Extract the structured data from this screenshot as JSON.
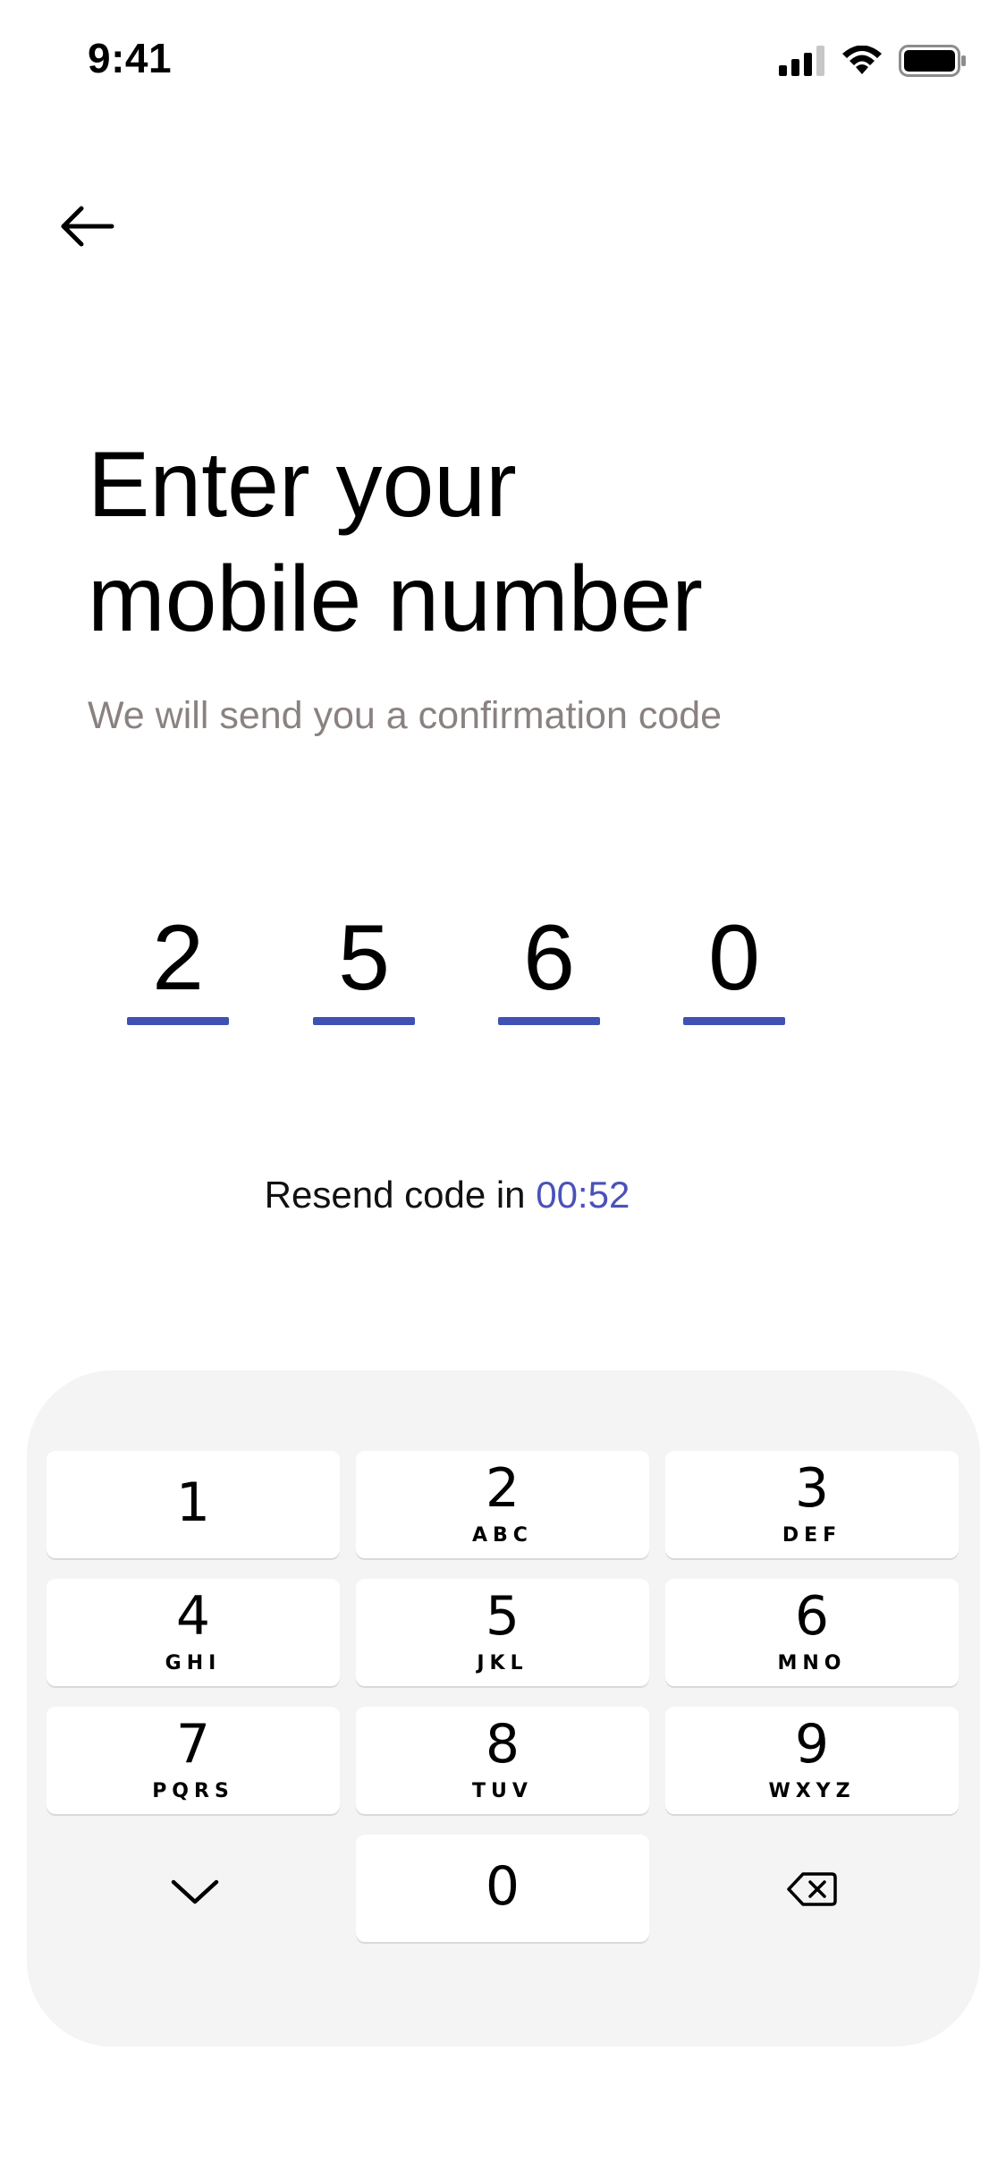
{
  "status_bar": {
    "time": "9:41",
    "icons": [
      "cellular-signal-icon",
      "wifi-icon",
      "battery-icon"
    ]
  },
  "header": {
    "back_icon": "arrow-left-icon"
  },
  "title": {
    "line1": "Enter your",
    "line2": "mobile number"
  },
  "subtitle": "We will send you a confirmation code",
  "code": {
    "digits": [
      "2",
      "5",
      "6",
      "0"
    ],
    "underline_color": "#3f51b5"
  },
  "resend": {
    "label": "Resend code in ",
    "timer": "00:52"
  },
  "keypad": {
    "keys": [
      {
        "digit": "1",
        "letters": ""
      },
      {
        "digit": "2",
        "letters": "ABC"
      },
      {
        "digit": "3",
        "letters": "DEF"
      },
      {
        "digit": "4",
        "letters": "GHI"
      },
      {
        "digit": "5",
        "letters": "JKL"
      },
      {
        "digit": "6",
        "letters": "MNO"
      },
      {
        "digit": "7",
        "letters": "PQRS"
      },
      {
        "digit": "8",
        "letters": "TUV"
      },
      {
        "digit": "9",
        "letters": "WXYZ"
      },
      {
        "digit": "0",
        "letters": ""
      }
    ],
    "hide_icon": "chevron-down-icon",
    "delete_icon": "backspace-icon"
  },
  "colors": {
    "accent": "#3f51b5",
    "timer": "#4a52b8",
    "subtitle": "#8a8280",
    "keypad_background": "#f4f4f4"
  }
}
